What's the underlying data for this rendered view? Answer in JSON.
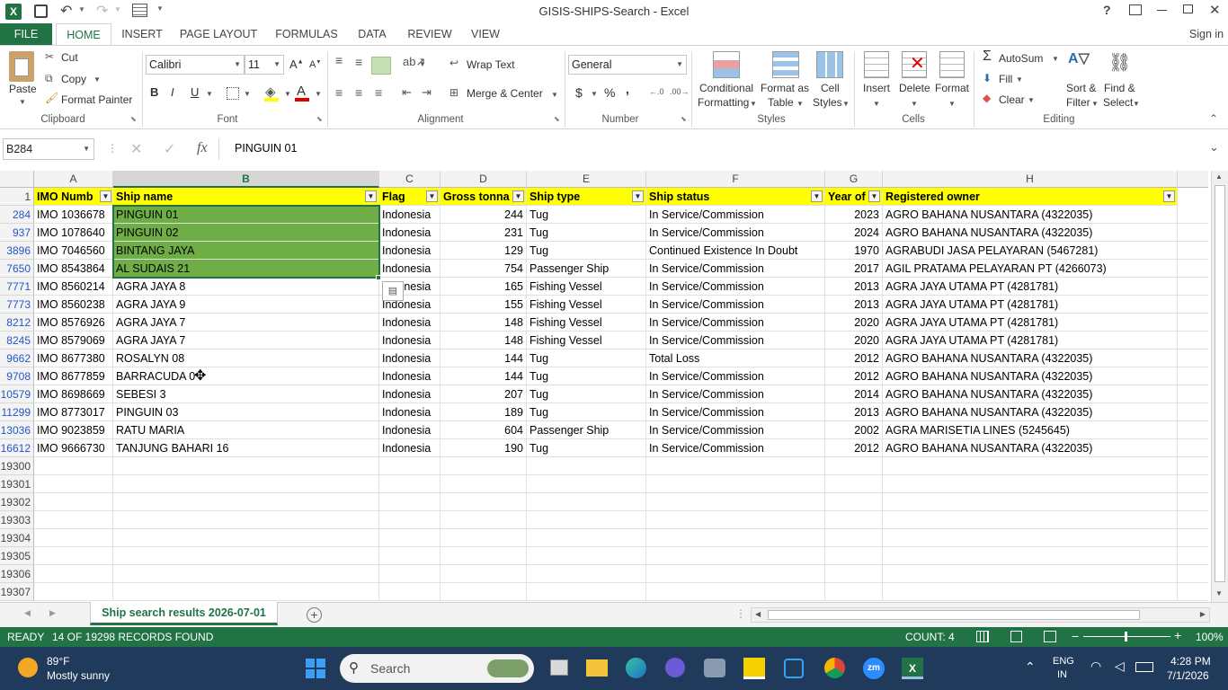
{
  "title": "GISIS-SHIPS-Search - Excel",
  "user": "Sign in",
  "ribbon_tabs": [
    "FILE",
    "HOME",
    "INSERT",
    "PAGE LAYOUT",
    "FORMULAS",
    "DATA",
    "REVIEW",
    "VIEW"
  ],
  "clipboard": {
    "paste": "Paste",
    "cut": "Cut",
    "copy": "Copy",
    "format_painter": "Format Painter",
    "label": "Clipboard"
  },
  "font": {
    "name": "Calibri",
    "size": "11",
    "bold": "B",
    "italic": "I",
    "underline": "U",
    "label": "Font"
  },
  "alignment": {
    "wrap": "Wrap Text",
    "merge": "Merge & Center",
    "label": "Alignment"
  },
  "number": {
    "format": "General",
    "currency": "$",
    "percent": "%",
    "comma": ",",
    "label": "Number"
  },
  "styles": {
    "conditional": "Conditional",
    "conditional2": "Formatting",
    "format_table": "Format as",
    "format_table2": "Table",
    "cell_styles": "Cell",
    "cell_styles2": "Styles",
    "label": "Styles"
  },
  "cells": {
    "insert": "Insert",
    "delete": "Delete",
    "format": "Format",
    "label": "Cells"
  },
  "editing": {
    "autosum": "AutoSum",
    "fill": "Fill",
    "clear": "Clear",
    "sort": "Sort &",
    "sort2": "Filter",
    "find": "Find &",
    "find2": "Select",
    "label": "Editing"
  },
  "namebox": "B284",
  "fx": "fx",
  "formula": "PINGUIN 01",
  "col_letters": [
    "A",
    "B",
    "C",
    "D",
    "E",
    "F",
    "G",
    "H",
    "I"
  ],
  "headers": [
    "IMO Numb",
    "Ship name",
    "Flag",
    "Gross tonna",
    "Ship type",
    "Ship status",
    "Year of",
    "Registered owner"
  ],
  "rows": [
    {
      "n": "284",
      "imo": "IMO 1036678",
      "name": "PINGUIN 01",
      "flag": "Indonesia",
      "gt": "244",
      "type": "Tug",
      "status": "In Service/Commission",
      "year": "2023",
      "owner": "AGRO BAHANA NUSANTARA (4322035)"
    },
    {
      "n": "937",
      "imo": "IMO 1078640",
      "name": "PINGUIN 02",
      "flag": "Indonesia",
      "gt": "231",
      "type": "Tug",
      "status": "In Service/Commission",
      "year": "2024",
      "owner": "AGRO BAHANA NUSANTARA (4322035)"
    },
    {
      "n": "3896",
      "imo": "IMO 7046560",
      "name": "BINTANG JAYA",
      "flag": "Indonesia",
      "gt": "129",
      "type": "Tug",
      "status": "Continued Existence In Doubt",
      "year": "1970",
      "owner": "AGRABUDI JASA PELAYARAN (5467281)"
    },
    {
      "n": "7650",
      "imo": "IMO 8543864",
      "name": "AL SUDAIS 21",
      "flag": "Indonesia",
      "gt": "754",
      "type": "Passenger Ship",
      "status": "In Service/Commission",
      "year": "2017",
      "owner": "AGIL PRATAMA PELAYARAN PT (4266073)"
    },
    {
      "n": "7771",
      "imo": "IMO 8560214",
      "name": "AGRA JAYA 8",
      "flag": "Indonesia",
      "gt": "165",
      "type": "Fishing Vessel",
      "status": "In Service/Commission",
      "year": "2013",
      "owner": "AGRA JAYA UTAMA PT (4281781)"
    },
    {
      "n": "7773",
      "imo": "IMO 8560238",
      "name": "AGRA JAYA 9",
      "flag": "Indonesia",
      "gt": "155",
      "type": "Fishing Vessel",
      "status": "In Service/Commission",
      "year": "2013",
      "owner": "AGRA JAYA UTAMA PT (4281781)"
    },
    {
      "n": "8212",
      "imo": "IMO 8576926",
      "name": "AGRA JAYA 7",
      "flag": "Indonesia",
      "gt": "148",
      "type": "Fishing Vessel",
      "status": "In Service/Commission",
      "year": "2020",
      "owner": "AGRA JAYA UTAMA PT (4281781)"
    },
    {
      "n": "8245",
      "imo": "IMO 8579069",
      "name": "AGRA JAYA 7",
      "flag": "Indonesia",
      "gt": "148",
      "type": "Fishing Vessel",
      "status": "In Service/Commission",
      "year": "2020",
      "owner": "AGRA JAYA UTAMA PT (4281781)"
    },
    {
      "n": "9662",
      "imo": "IMO 8677380",
      "name": "ROSALYN 08",
      "flag": "Indonesia",
      "gt": "144",
      "type": "Tug",
      "status": "Total Loss",
      "year": "2012",
      "owner": "AGRO BAHANA NUSANTARA (4322035)"
    },
    {
      "n": "9708",
      "imo": "IMO 8677859",
      "name": "BARRACUDA 0",
      "flag": "Indonesia",
      "gt": "144",
      "type": "Tug",
      "status": "In Service/Commission",
      "year": "2012",
      "owner": "AGRO BAHANA NUSANTARA (4322035)"
    },
    {
      "n": "10579",
      "imo": "IMO 8698669",
      "name": "SEBESI 3",
      "flag": "Indonesia",
      "gt": "207",
      "type": "Tug",
      "status": "In Service/Commission",
      "year": "2014",
      "owner": "AGRO BAHANA NUSANTARA (4322035)"
    },
    {
      "n": "11299",
      "imo": "IMO 8773017",
      "name": "PINGUIN 03",
      "flag": "Indonesia",
      "gt": "189",
      "type": "Tug",
      "status": "In Service/Commission",
      "year": "2013",
      "owner": "AGRO BAHANA NUSANTARA (4322035)"
    },
    {
      "n": "13036",
      "imo": "IMO 9023859",
      "name": "RATU MARIA",
      "flag": "Indonesia",
      "gt": "604",
      "type": "Passenger Ship",
      "status": "In Service/Commission",
      "year": "2002",
      "owner": "AGRA MARISETIA LINES (5245645)"
    },
    {
      "n": "16612",
      "imo": "IMO 9666730",
      "name": "TANJUNG BAHARI 16",
      "flag": "Indonesia",
      "gt": "190",
      "type": "Tug",
      "status": "In Service/Commission",
      "year": "2012",
      "owner": "AGRO BAHANA NUSANTARA (4322035)"
    }
  ],
  "empty_rows": [
    "19300",
    "19301",
    "19302",
    "19303",
    "19304",
    "19305",
    "19306",
    "19307"
  ],
  "sheet_tab": "Ship search results 2026-07-01",
  "status": {
    "ready": "READY",
    "records": "14 OF 19298 RECORDS FOUND",
    "count": "COUNT: 4",
    "zoom": "100%"
  },
  "weather": {
    "temp": "89°F",
    "desc": "Mostly sunny"
  },
  "taskbar": {
    "search": "Search",
    "lang": "ENG",
    "lang2": "IN",
    "time": "4:28 PM",
    "date": "7/1/2026"
  },
  "colors": {
    "excel_green": "#217346",
    "selection": "#6fad47",
    "header_yellow": "#ffff00"
  }
}
